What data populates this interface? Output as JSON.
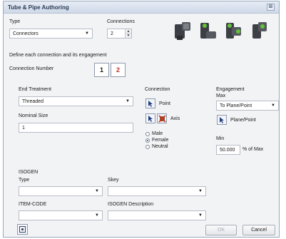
{
  "window": {
    "title": "Tube & Pipe Authoring",
    "close_glyph": "⊠"
  },
  "type": {
    "label": "Type",
    "value": "Connectors"
  },
  "connections": {
    "label": "Connections",
    "value": "2"
  },
  "define_text": "Define each connection and its engagement",
  "connection_number": {
    "label": "Connection Number",
    "tabs": [
      "1",
      "2"
    ]
  },
  "end_treatment": {
    "label": "End Treatment",
    "value": "Threaded"
  },
  "nominal_size": {
    "label": "Nominal Size",
    "value": "1"
  },
  "connection": {
    "label": "Connection",
    "point_label": "Point",
    "axis_label": "Axis",
    "radios": [
      {
        "label": "Male",
        "selected": false
      },
      {
        "label": "Female",
        "selected": true
      },
      {
        "label": "Neutral",
        "selected": false
      }
    ]
  },
  "engagement": {
    "label": "Engagement",
    "max_label": "Max",
    "max_value": "To Plane/Point",
    "plane_point_label": "Plane/Point",
    "min_label": "Min",
    "min_value": "50.000",
    "min_unit": "% of Max"
  },
  "isogen": {
    "section_label": "ISOGEN",
    "type_label": "Type",
    "skey_label": "Skey",
    "item_code_label": "ITEM-CODE",
    "description_label": "ISOGEN Description"
  },
  "footer": {
    "ok_label": "OK",
    "cancel_label": "Cancel"
  }
}
